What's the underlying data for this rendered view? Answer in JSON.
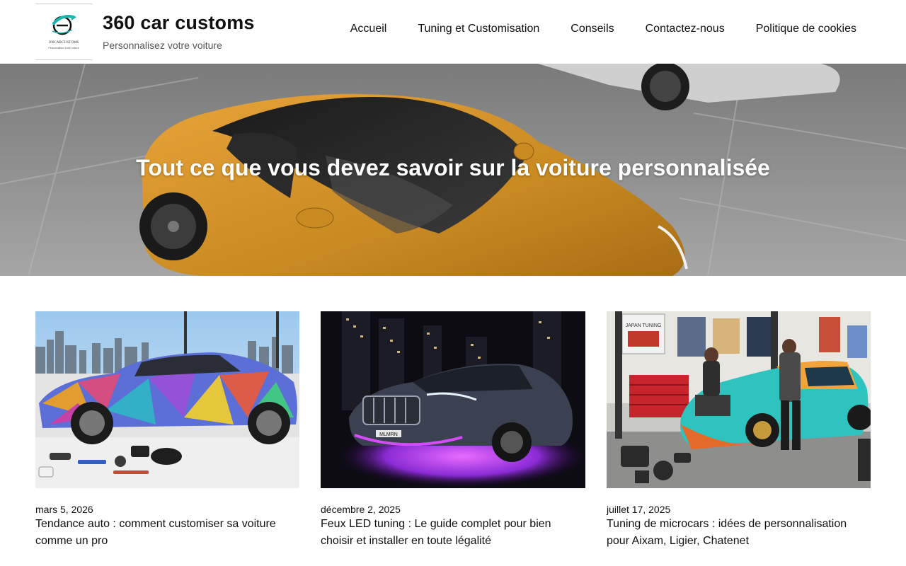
{
  "brand": {
    "title": "360 car customs",
    "tagline": "Personnalisez votre voiture",
    "logo_text": "360CARCUSTOMS",
    "logo_subtext": "Personnalisez votre voiture",
    "accent_color": "#1bb5b0"
  },
  "nav": {
    "items": [
      {
        "label": "Accueil"
      },
      {
        "label": "Tuning et Customisation"
      },
      {
        "label": "Conseils"
      },
      {
        "label": "Contactez-nous"
      },
      {
        "label": "Politique de cookies"
      }
    ]
  },
  "hero": {
    "title": "Tout ce que vous devez savoir sur la voiture personnalisée"
  },
  "posts": [
    {
      "date": "mars 5, 2026",
      "title": "Tendance auto : comment customiser sa voiture comme un pro"
    },
    {
      "date": "décembre 2, 2025",
      "title": "Feux LED tuning : Le guide complet pour bien choisir et installer en toute légalité",
      "plate_text": "MLMRN"
    },
    {
      "date": "juillet 17, 2025",
      "title": "Tuning de microcars : idées de personnalisation pour Aixam, Ligier, Chatenet",
      "poster_text": "JAPAN TUNING"
    }
  ]
}
